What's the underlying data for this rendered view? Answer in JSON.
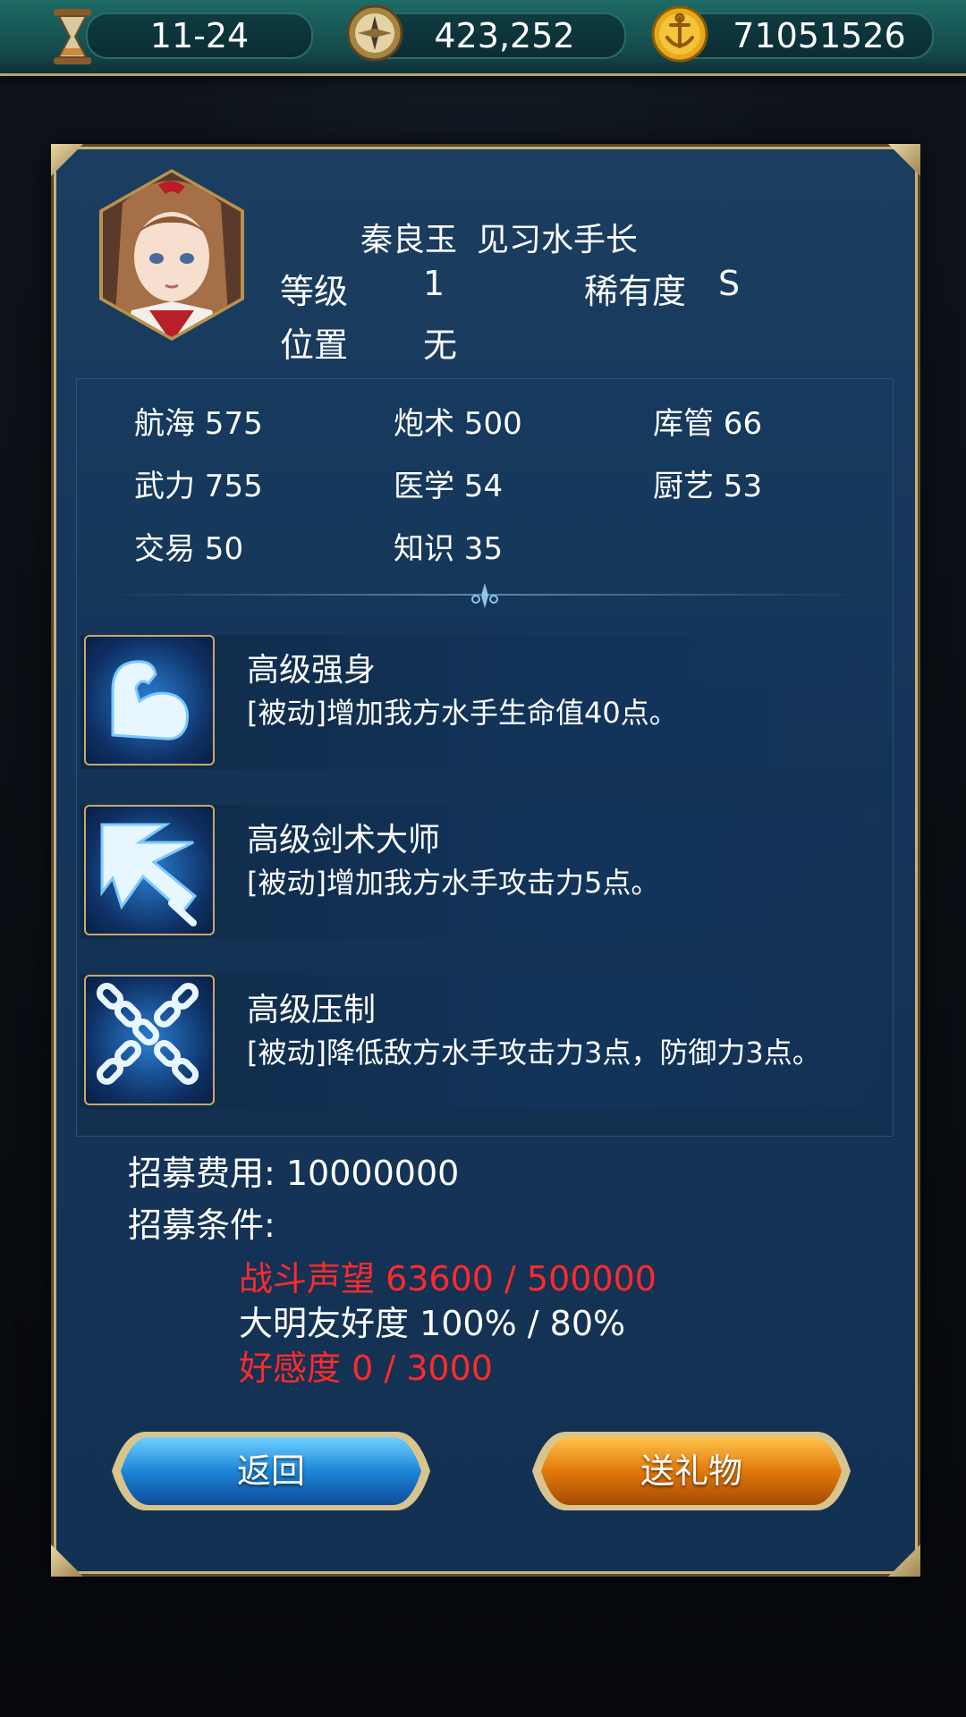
{
  "topbar": {
    "date": "11-24",
    "compass_value": "423,252",
    "gold_value": "71051526",
    "icons": [
      "hourglass-icon",
      "compass-icon",
      "anchor-coin-icon"
    ]
  },
  "character": {
    "name": "秦良玉",
    "title": "见习水手长",
    "level_label": "等级",
    "level_value": "1",
    "rarity_label": "稀有度",
    "rarity_value": "S",
    "position_label": "位置",
    "position_value": "无"
  },
  "stats": [
    {
      "label": "航海 575"
    },
    {
      "label": "炮术 500"
    },
    {
      "label": "库管 66"
    },
    {
      "label": "武力 755"
    },
    {
      "label": "医学 54"
    },
    {
      "label": "厨艺 53"
    },
    {
      "label": "交易 50"
    },
    {
      "label": "知识 35"
    }
  ],
  "skills": [
    {
      "title": "高级强身",
      "desc": "[被动]增加我方水手生命值40点。",
      "icon": "muscle-arm-icon"
    },
    {
      "title": "高级剑术大师",
      "desc": "[被动]增加我方水手攻击力5点。",
      "icon": "sword-slash-icon"
    },
    {
      "title": "高级压制",
      "desc": "[被动]降低敌方水手攻击力3点，防御力3点。",
      "icon": "crossed-chains-icon"
    }
  ],
  "recruit": {
    "cost_text": "招募费用: 10000000",
    "conditions_label": "招募条件:",
    "conditions": [
      {
        "text": "战斗声望 63600 / 500000",
        "met": false
      },
      {
        "text": "大明友好度 100% / 80%",
        "met": true
      },
      {
        "text": "好感度 0 / 3000",
        "met": false
      }
    ]
  },
  "buttons": {
    "back": "返回",
    "gift": "送礼物"
  },
  "colors": {
    "unmet": "#ff2a2a",
    "met": "#ffffff",
    "frame_gold": "#c9b07a",
    "panel_blue": "#15355a"
  }
}
